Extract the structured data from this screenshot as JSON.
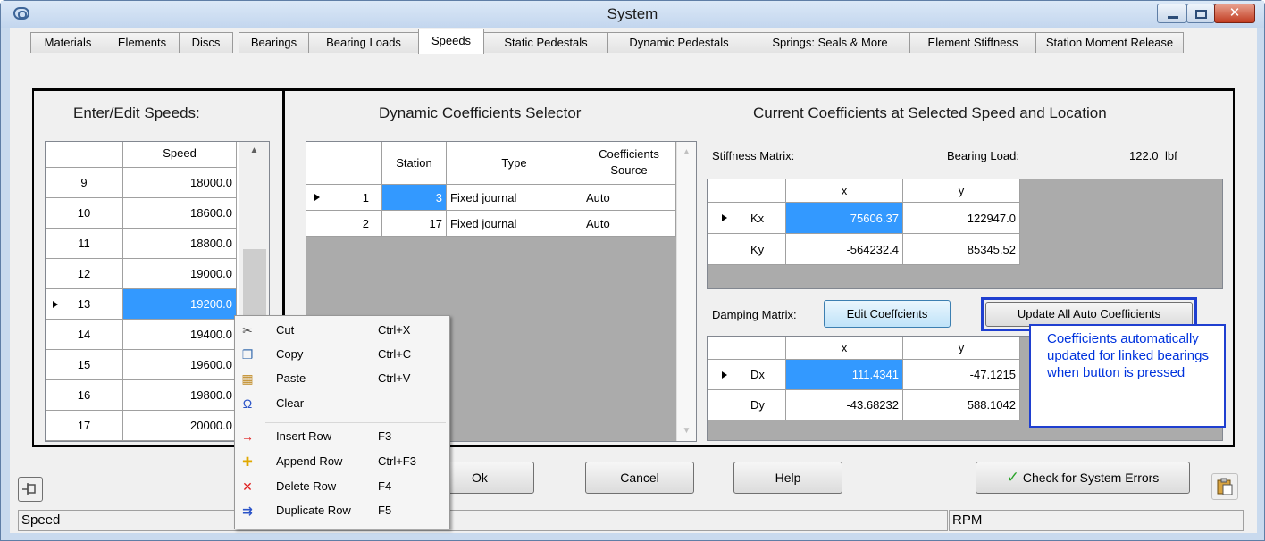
{
  "window": {
    "title": "System"
  },
  "tabs": [
    {
      "label": "Materials"
    },
    {
      "label": "Elements"
    },
    {
      "label": "Discs"
    },
    {
      "label": "Bearings"
    },
    {
      "label": "Bearing Loads"
    },
    {
      "label": "Speeds"
    },
    {
      "label": "Static Pedestals"
    },
    {
      "label": "Dynamic Pedestals"
    },
    {
      "label": "Springs: Seals & More"
    },
    {
      "label": "Element Stiffness"
    },
    {
      "label": "Station Moment Release"
    }
  ],
  "speeds": {
    "heading": "Enter/Edit Speeds:",
    "column": "Speed",
    "rows": [
      {
        "index": "9",
        "value": "18000.0"
      },
      {
        "index": "10",
        "value": "18600.0"
      },
      {
        "index": "11",
        "value": "18800.0"
      },
      {
        "index": "12",
        "value": "19000.0"
      },
      {
        "index": "13",
        "value": "19200.0"
      },
      {
        "index": "14",
        "value": "19400.0"
      },
      {
        "index": "15",
        "value": "19600.0"
      },
      {
        "index": "16",
        "value": "19800.0"
      },
      {
        "index": "17",
        "value": "20000.0"
      }
    ]
  },
  "selector": {
    "heading": "Dynamic Coefficients Selector",
    "columns": {
      "station": "Station",
      "type": "Type",
      "source": "Coefficients Source"
    },
    "rows": [
      {
        "index": "1",
        "station": "3",
        "type": "Fixed journal",
        "source": "Auto"
      },
      {
        "index": "2",
        "station": "17",
        "type": "Fixed journal",
        "source": "Auto"
      }
    ]
  },
  "coefficients": {
    "heading": "Current Coefficients at Selected Speed and Location",
    "stiffness_label": "Stiffness Matrix:",
    "bearing_load_label": "Bearing Load:",
    "bearing_load_value": "122.0",
    "bearing_load_unit": "lbf",
    "stiffness": {
      "col_x": "x",
      "col_y": "y",
      "rows": [
        {
          "label": "Kx",
          "x": "75606.37",
          "y": "122947.0"
        },
        {
          "label": "Ky",
          "x": "-564232.4",
          "y": "85345.52"
        }
      ]
    },
    "damping_label": "Damping Matrix:",
    "edit_button": "Edit Coeffcients",
    "update_button": "Update All Auto Coefficients",
    "damping": {
      "col_x": "x",
      "col_y": "y",
      "rows": [
        {
          "label": "Dx",
          "x": "111.4341",
          "y": "-47.1215"
        },
        {
          "label": "Dy",
          "x": "-43.68232",
          "y": "588.1042"
        }
      ]
    },
    "callout": "Coefficients automatically updated for linked bearings when button is pressed"
  },
  "buttons": {
    "ok": "Ok",
    "cancel": "Cancel",
    "help": "Help",
    "check": "Check for System Errors"
  },
  "context_menu": [
    {
      "label": "Cut",
      "shortcut": "Ctrl+X",
      "icon": "scissors-icon"
    },
    {
      "label": "Copy",
      "shortcut": "Ctrl+C",
      "icon": "copy-icon"
    },
    {
      "label": "Paste",
      "shortcut": "Ctrl+V",
      "icon": "paste-icon"
    },
    {
      "label": "Clear",
      "shortcut": "",
      "icon": "eraser-icon"
    },
    {
      "label": "Insert Row",
      "shortcut": "F3",
      "icon": "insert-row-icon"
    },
    {
      "label": "Append Row",
      "shortcut": "Ctrl+F3",
      "icon": "append-row-icon"
    },
    {
      "label": "Delete Row",
      "shortcut": "F4",
      "icon": "delete-row-icon"
    },
    {
      "label": "Duplicate Row",
      "shortcut": "F5",
      "icon": "duplicate-row-icon"
    }
  ],
  "status": {
    "left": "Speed",
    "right": "RPM"
  },
  "colors": {
    "selection": "#3399ff",
    "callout_border": "#1f3fd0",
    "callout_text": "#0033dd"
  }
}
